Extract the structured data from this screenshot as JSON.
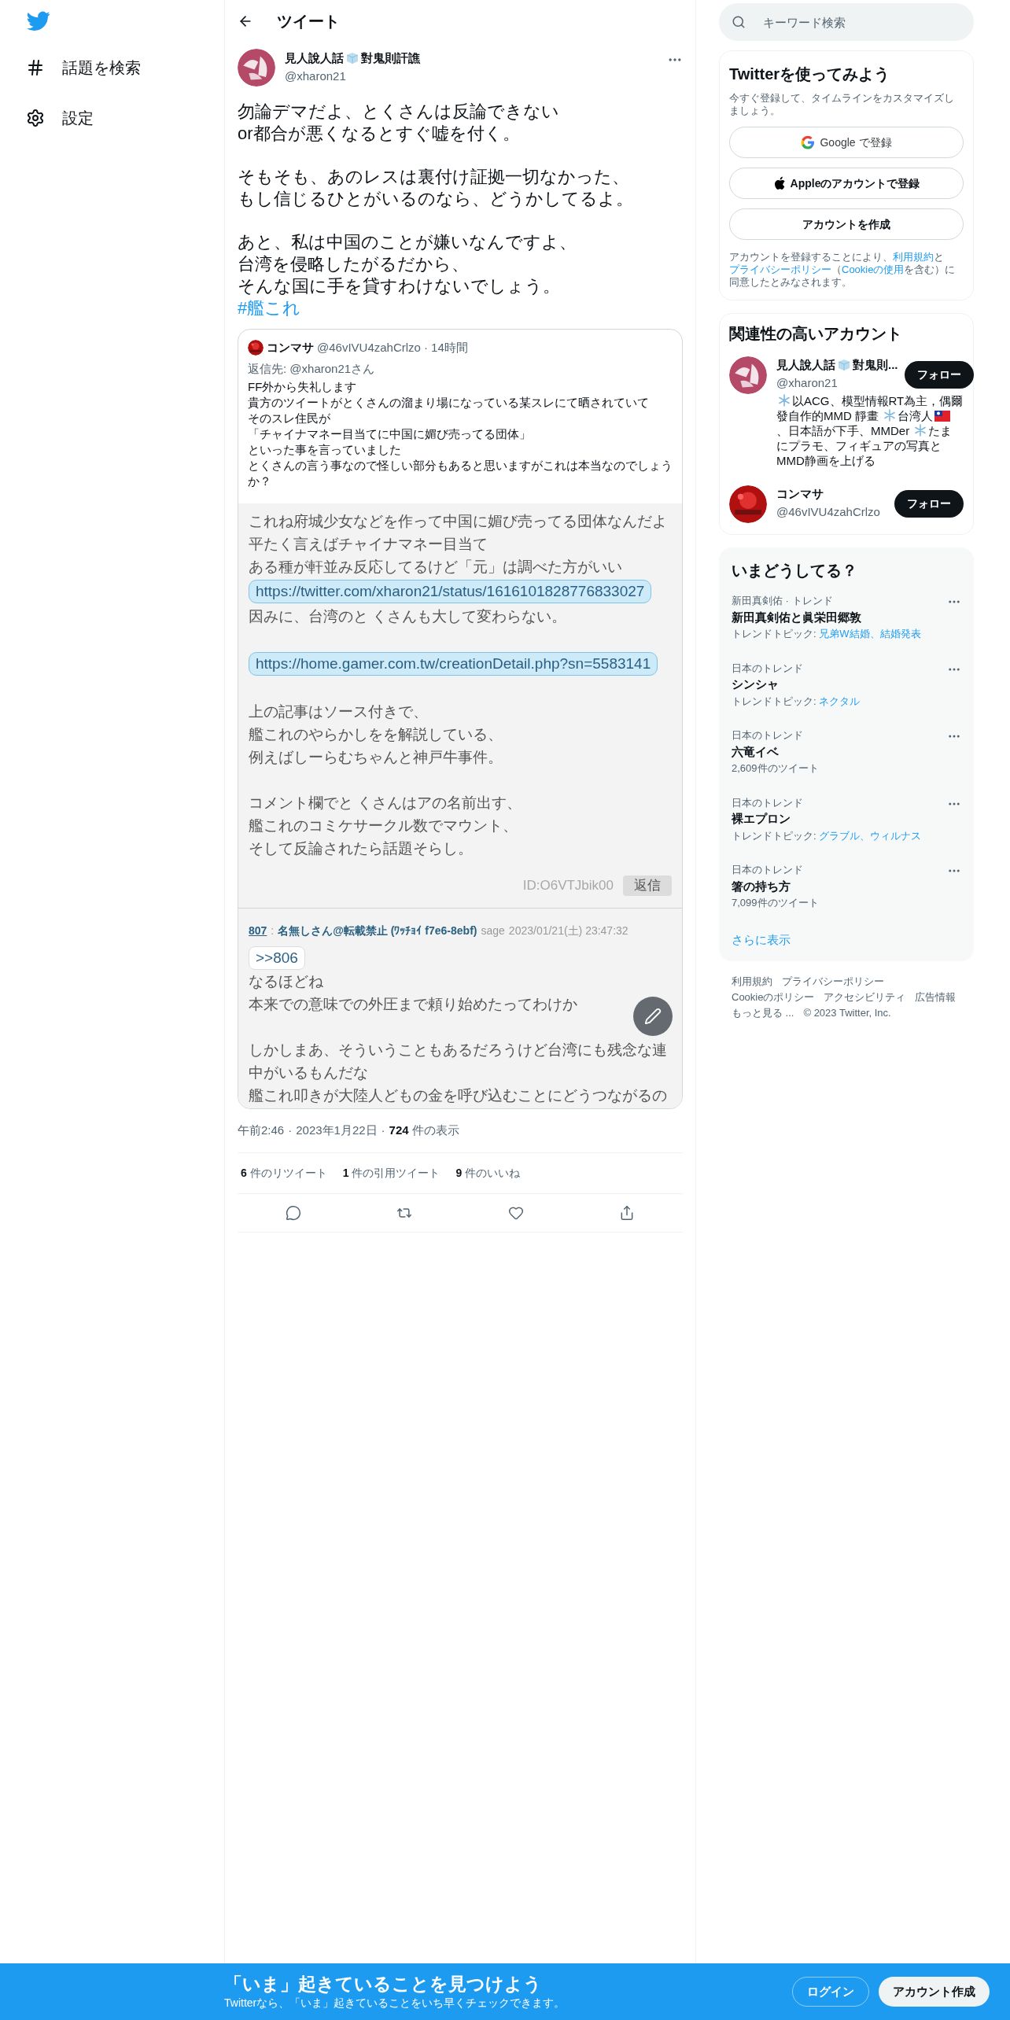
{
  "nav": {
    "items": [
      {
        "kind": "hash",
        "label": "話題を検索"
      },
      {
        "kind": "gear",
        "label": "設定"
      }
    ]
  },
  "header": {
    "title": "ツイート"
  },
  "tweet": {
    "name_before": "見人說人話",
    "name_after": "對鬼則訐譙",
    "handle": "@xharon21",
    "paragraphs": [
      [
        "勿論デマだよ、とくさんは反論できない",
        "or都合が悪くなるとすぐ嘘を付く。"
      ],
      [
        "そもそも、あのレスは裏付け証拠一切なかった、",
        "もし信じるひとがいるのなら、どうかしてるよ。"
      ],
      [
        "あと、私は中国のことが嫌いなんですよ、",
        "台湾を侵略したがるだから、",
        "そんな国に手を貸すわけないでしょう。"
      ]
    ],
    "hashtag": "#艦これ",
    "quote": {
      "name": "コンマサ",
      "handle": "@46vIVU4zahCrlzo",
      "time": "· 14時間",
      "reply_to": "返信先: @xharon21さん",
      "lines": [
        "FF外から失礼します",
        "貴方のツイートがとくさんの溜まり場になっている某スレにて晒されていて",
        "そのスレ住民が",
        "「チャイナマネー目当てに中国に媚び売ってる団体」",
        "といった事を言っていました",
        "とくさんの言う事なので怪しい部分もあると思いますがこれは本当なのでしょうか？"
      ],
      "screenshot": {
        "post_1": {
          "lines": [
            {
              "kind": "text",
              "text": "これね府城少女などを作って中国に媚び売ってる団体なんだよ"
            },
            {
              "kind": "text",
              "text": "平たく言えばチャイナマネー目当て"
            },
            {
              "kind": "text",
              "text": "ある種が軒並み反応してるけど「元」は調べた方がいい"
            },
            {
              "kind": "link",
              "text": "https://twitter.com/xharon21/status/1616101828776833027"
            },
            {
              "kind": "text",
              "text": "因みに、台湾のと くさんも大して変わらない。"
            },
            {
              "kind": "gap"
            },
            {
              "kind": "link",
              "text": "https://home.gamer.com.tw/creationDetail.php?sn=5583141"
            },
            {
              "kind": "gap"
            },
            {
              "kind": "text",
              "text": "上の記事はソース付きで、"
            },
            {
              "kind": "text",
              "text": "艦これのやらかしをを解説している、"
            },
            {
              "kind": "text",
              "text": "例えばしーらむちゃんと神戸牛事件。"
            },
            {
              "kind": "gap"
            },
            {
              "kind": "text",
              "text": "コメント欄でと くさんはアの名前出す、"
            },
            {
              "kind": "text",
              "text": "艦これのコミケサークル数でマウント、"
            },
            {
              "kind": "text",
              "text": "そして反論されたら話題そらし。"
            }
          ],
          "id": "ID:O6VTJbik00",
          "reply_button": "返信"
        },
        "post_2": {
          "number": "807",
          "separator": ":",
          "name": "名無しさん@転載禁止 (ﾜｯﾁｮｲ f7e6-8ebf)",
          "mail": "sage",
          "date": "2023/01/21(土) 23:47:32",
          "anchor": ">>806",
          "lines": [
            {
              "kind": "text",
              "text": "なるほどね"
            },
            {
              "kind": "text",
              "text": "本来での意味での外圧まで頼り始めたってわけか"
            },
            {
              "kind": "gap"
            },
            {
              "kind": "text",
              "text": "しかしまあ、そういうこともあるだろうけど台湾にも残念な連中がいるもんだな"
            },
            {
              "kind": "text",
              "text": "艦これ叩きが大陸人どもの金を呼び込むことにどうつながるの"
            }
          ]
        }
      }
    },
    "meta": {
      "time": "午前2:46",
      "separator": "·",
      "date": "2023年1月22日",
      "views_count": "724",
      "views_label": "件の表示"
    },
    "counts": [
      {
        "count": "6",
        "label": "件のリツイート"
      },
      {
        "count": "1",
        "label": "件の引用ツイート"
      },
      {
        "count": "9",
        "label": "件のいいね"
      }
    ],
    "actions": [
      {
        "kind": "reply"
      },
      {
        "kind": "retweet"
      },
      {
        "kind": "like"
      },
      {
        "kind": "share"
      }
    ]
  },
  "search": {
    "placeholder": "キーワード検索"
  },
  "signup": {
    "title": "Twitterを使ってみよう",
    "subtitle": "今すぐ登録して、タイムラインをカスタマイズしましょう。",
    "buttons": [
      {
        "kind": "google",
        "label": "Google で登録"
      },
      {
        "kind": "apple",
        "label": "Appleのアカウントで登録"
      },
      {
        "kind": "plain",
        "label": "アカウントを作成"
      }
    ],
    "legal": [
      {
        "kind": "text",
        "text": "アカウントを登録することにより、"
      },
      {
        "kind": "link",
        "text": "利用規約"
      },
      {
        "kind": "text",
        "text": "と"
      },
      {
        "kind": "link",
        "text": "プライバシーポリシー"
      },
      {
        "kind": "text",
        "text": "（"
      },
      {
        "kind": "link",
        "text": "Cookieの使用"
      },
      {
        "kind": "text",
        "text": "を含む）に同意したとみなされます。"
      }
    ]
  },
  "related": {
    "title": "関連性の高いアカウント",
    "accounts": [
      {
        "name_before": "見人說人話",
        "name_after": "對鬼則...",
        "handle": "@xharon21",
        "follow": "フォロー",
        "bio": [
          {
            "kind": "snowflake"
          },
          {
            "kind": "text",
            "text": "以ACG、模型情報RT為主，偶爾發自作的MMD 靜畫 "
          },
          {
            "kind": "snowflake"
          },
          {
            "kind": "text",
            "text": "台湾人"
          },
          {
            "kind": "flag"
          },
          {
            "kind": "text",
            "text": "、日本語が下手、MMDer "
          },
          {
            "kind": "snowflake"
          },
          {
            "kind": "text",
            "text": "たまにプラモ、フィギュアの写真とMMD静画を上げる"
          }
        ]
      },
      {
        "name_before": "コンマサ",
        "handle": "@46vIVU4zahCrlzo",
        "follow": "フォロー"
      }
    ]
  },
  "trends": {
    "title": "いまどうしてる？",
    "items": [
      {
        "context": "新田真剣佑 · トレンド",
        "name": "新田真剣佑と眞栄田郷敦",
        "kind": "topics",
        "topics_label": "トレンドトピック: ",
        "topics": "兄弟W結婚、結婚発表"
      },
      {
        "context": "日本のトレンド",
        "name": "シンシャ",
        "kind": "topics",
        "topics_label": "トレンドトピック: ",
        "topics": "ネクタル"
      },
      {
        "context": "日本のトレンド",
        "name": "六竜イベ",
        "kind": "count",
        "count": "2,609件のツイート"
      },
      {
        "context": "日本のトレンド",
        "name": "裸エプロン",
        "kind": "topics",
        "topics_label": "トレンドトピック: ",
        "topics": "グラブル、ウィルナス"
      },
      {
        "context": "日本のトレンド",
        "name": "箸の持ち方",
        "kind": "count",
        "count": "7,099件のツイート"
      }
    ],
    "more": "さらに表示"
  },
  "footer": {
    "links": [
      "利用規約",
      "プライバシーポリシー",
      "Cookieのポリシー",
      "アクセシビリティ",
      "広告情報",
      "もっと見る ..."
    ],
    "copyright": "© 2023 Twitter, Inc."
  },
  "bottom_bar": {
    "title": "「いま」起きていることを見つけよう",
    "subtitle": "Twitterなら、「いま」起きていることをいち早くチェックできます。",
    "login": "ログイン",
    "signup": "アカウント作成"
  }
}
